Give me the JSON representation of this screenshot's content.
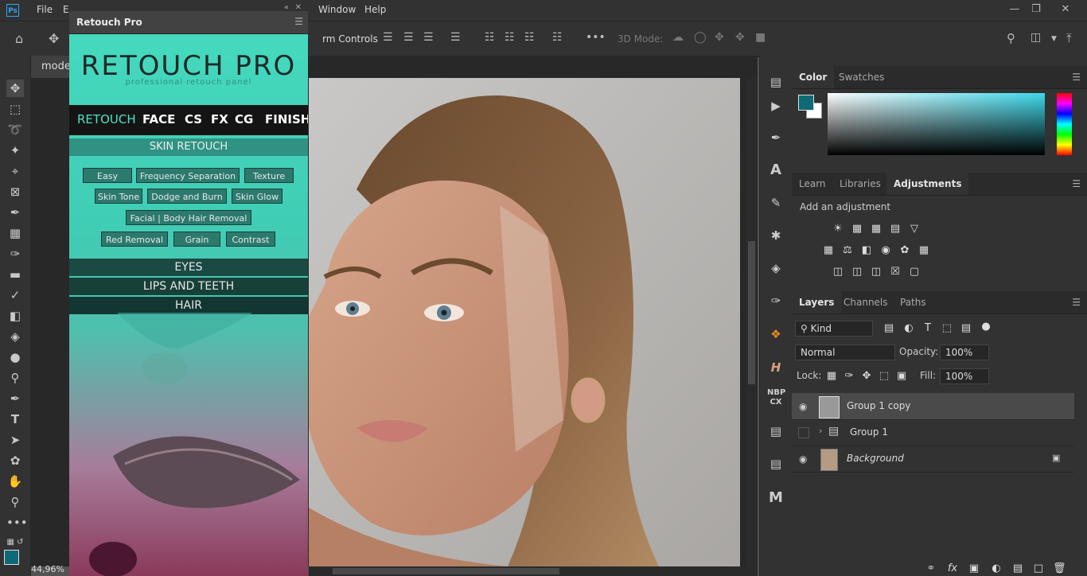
{
  "menubar": {
    "app_icon": "Ps",
    "items": [
      "File",
      "E",
      "Window",
      "Help"
    ]
  },
  "options_bar": {
    "transform_controls_label": "rm Controls",
    "mode_3d_label": "3D Mode:"
  },
  "document": {
    "tab_label": "mode",
    "zoom": "44,96%"
  },
  "retouch_panel": {
    "title": "Retouch Pro",
    "logo": "RETOUCH PRO",
    "subtitle": "professional retouch panel",
    "nav": [
      "RETOUCH",
      "FACE",
      "CS",
      "FX",
      "CG",
      "FINISH"
    ],
    "active_nav": "RETOUCH",
    "skin_header": "SKIN RETOUCH",
    "buttons": [
      "Easy",
      "Frequency Separation",
      "Texture",
      "Skin Tone",
      "Dodge and Burn",
      "Skin Glow",
      "Facial | Body Hair Removal",
      "Red Removal",
      "Grain",
      "Contrast"
    ],
    "sections": [
      "EYES",
      "LIPS AND TEETH",
      "HAIR"
    ]
  },
  "color_panel": {
    "tabs": [
      "Color",
      "Swatches"
    ],
    "foreground": "#0f6a78",
    "background": "#ffffff"
  },
  "adjustments_panel": {
    "tabs": [
      "Learn",
      "Libraries",
      "Adjustments"
    ],
    "hint": "Add an adjustment"
  },
  "layers_panel": {
    "tabs": [
      "Layers",
      "Channels",
      "Paths"
    ],
    "filter": "Kind",
    "blend_mode": "Normal",
    "opacity_label": "Opacity:",
    "opacity": "100%",
    "lock_label": "Lock:",
    "fill_label": "Fill:",
    "fill": "100%",
    "layers": [
      {
        "name": "Group 1 copy",
        "visible": true,
        "selected": true
      },
      {
        "name": "Group 1",
        "visible": false,
        "selected": false
      },
      {
        "name": "Background",
        "visible": true,
        "selected": false
      }
    ]
  },
  "right_icons": {
    "nbp_label": "NBP",
    "cx_label": "CX"
  }
}
